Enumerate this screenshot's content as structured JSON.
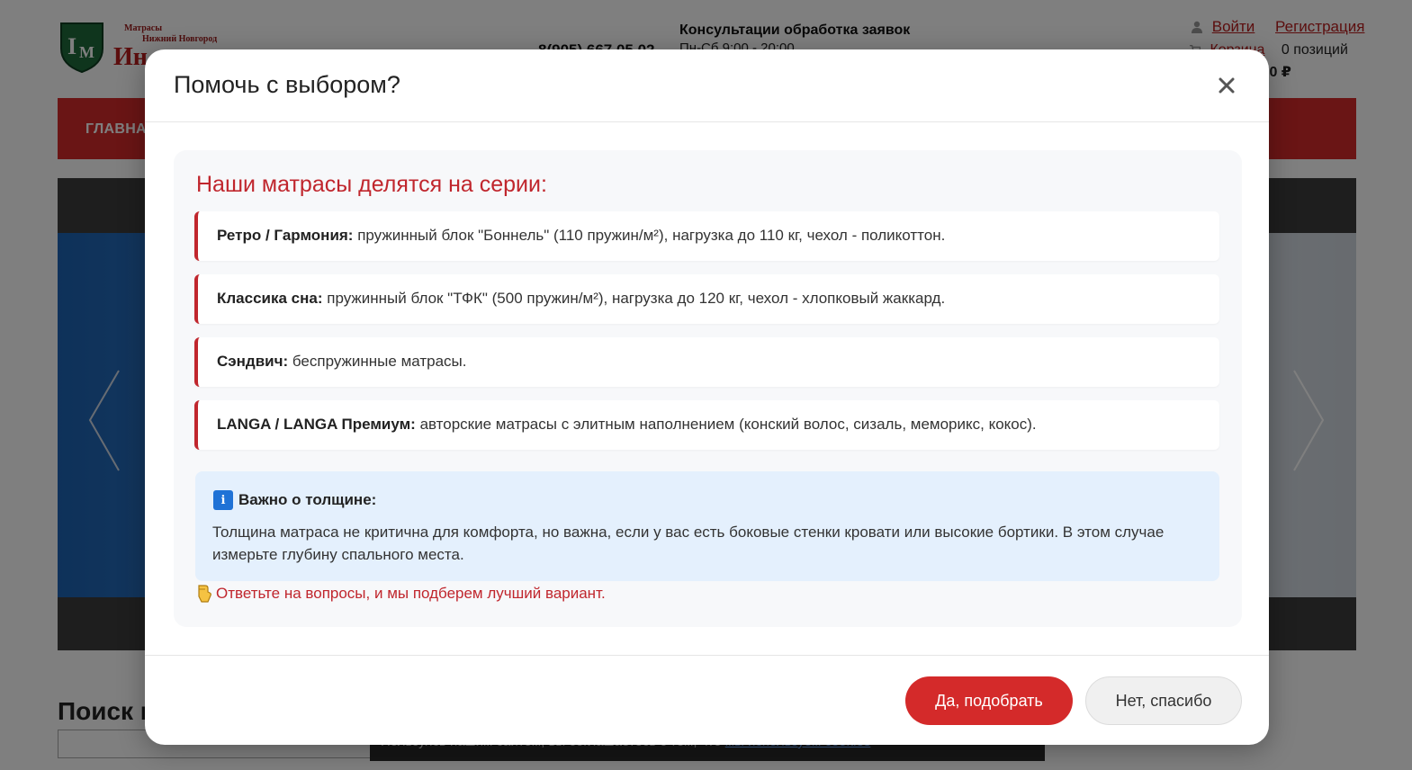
{
  "header": {
    "logo_line1": "Матрасы",
    "logo_line2": "Нижний Новгород",
    "logo_brand": "Ин",
    "phone": "8(905) 667 05 02",
    "consult_title": "Консультации обработка заявок",
    "hours": "Пн-Сб 9:00 - 20:00",
    "login": "Войти",
    "register": "Регистрация",
    "cart_label": "Корзина",
    "cart_count": "0 позиций",
    "cart_sum_label": "у",
    "cart_sum": "0 ₽"
  },
  "nav": {
    "first_item": "ГЛАВНА"
  },
  "page": {
    "search_title": "Поиск г",
    "cookie_text": "Пользуясь нашим сайтом, вы соглашаетесь с тем, что",
    "cookie_link": "мы используем cookies"
  },
  "modal": {
    "title": "Помочь с выбором?",
    "close_symbol": "×",
    "heading": "Наши матрасы делятся на серии:",
    "series": [
      {
        "name": "Ретро / Гармония:",
        "desc": " пружинный блок \"Боннель\" (110 пружин/м²), нагрузка до 110 кг, чехол - поликоттон."
      },
      {
        "name": "Классика сна:",
        "desc": " пружинный блок \"ТФК\" (500 пружин/м²), нагрузка до 120 кг, чехол - хлопковый жаккард."
      },
      {
        "name": "Сэндвич:",
        "desc": " беспружинные матрасы."
      },
      {
        "name": "LANGA / LANGA Премиум:",
        "desc": " авторские матрасы с элитным наполнением (конский волос, сизаль, меморикс, кокос)."
      }
    ],
    "info": {
      "icon_letter": "i",
      "title": "Важно о толщине:",
      "text": "Толщина матраса не критична для комфорта, но важна, если у вас есть боковые стенки кровати или высокие бортики. В этом случае измерьте глубину спального места."
    },
    "hint": "Ответьте на вопросы, и мы подберем лучший вариант.",
    "buttons": {
      "yes": "Да, подобрать",
      "no": "Нет, спасибо"
    }
  },
  "colors": {
    "accent": "#d42a2a",
    "heading_red": "#c0262d",
    "info_bg": "#e4f0fd",
    "info_icon": "#1f72d6"
  },
  "icons": {
    "close": "close-icon",
    "info": "info-icon",
    "hint": "pointing-hand-icon",
    "user": "user-icon",
    "cart": "cart-icon"
  }
}
